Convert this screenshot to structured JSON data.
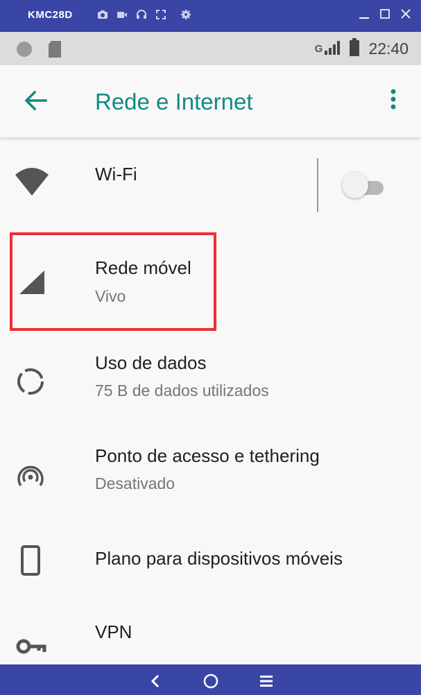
{
  "emulator": {
    "title": "KMC28D",
    "toolbar_icons": [
      "camera-icon",
      "video-icon",
      "headset-icon",
      "fullscreen-icon",
      "settings-icon"
    ],
    "window_controls": [
      "minimize-icon",
      "maximize-icon",
      "close-icon"
    ]
  },
  "status_bar": {
    "network": "G",
    "time": "22:40"
  },
  "app_bar": {
    "title": "Rede e Internet",
    "back_icon": "arrow-back-icon",
    "menu_icon": "more-vert-icon"
  },
  "settings": [
    {
      "title": "Wi-Fi",
      "subtitle": "",
      "icon": "wifi-icon",
      "toggle": false
    },
    {
      "title": "Rede móvel",
      "subtitle": "Vivo",
      "icon": "cellular-signal-icon",
      "highlighted": true
    },
    {
      "title": "Uso de dados",
      "subtitle": "75 B de dados utilizados",
      "icon": "data-usage-icon"
    },
    {
      "title": "Ponto de acesso e tethering",
      "subtitle": "Desativado",
      "icon": "hotspot-icon"
    },
    {
      "title": "Plano para dispositivos móveis",
      "subtitle": "",
      "icon": "phone-icon"
    },
    {
      "title": "VPN",
      "subtitle": "",
      "icon": "vpn-key-icon"
    }
  ],
  "nav_bar": {
    "buttons": [
      "back-nav-icon",
      "home-nav-icon",
      "menu-nav-icon"
    ]
  },
  "colors": {
    "accent": "#128a85",
    "frame": "#3a46a6",
    "highlight": "#ee2e32"
  }
}
